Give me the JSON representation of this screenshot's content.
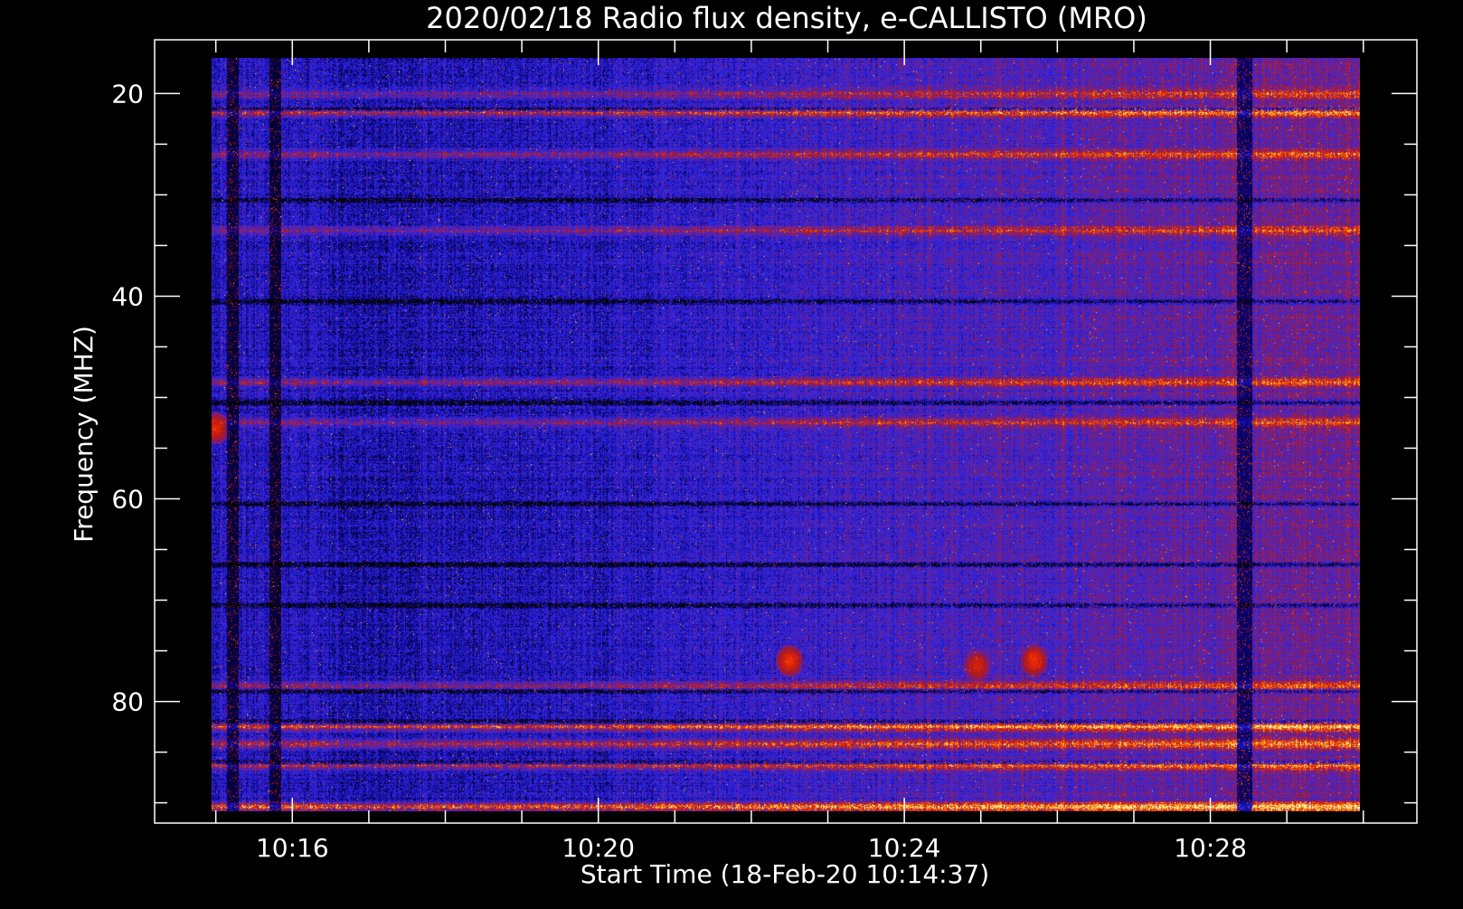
{
  "chart_data": {
    "type": "heatmap",
    "title": "2020/02/18  Radio flux density, e-CALLISTO (MRO)",
    "xlabel": "Start Time (18-Feb-20 10:14:37)",
    "ylabel": "Frequency (MHZ)",
    "x_axis": {
      "unit": "minutes after 10:00",
      "range": [
        14.2,
        30.7
      ],
      "data_range": [
        14.95,
        29.95
      ],
      "major_ticks": [
        {
          "value": 16,
          "label": "10:16"
        },
        {
          "value": 20,
          "label": "10:20"
        },
        {
          "value": 24,
          "label": "10:24"
        },
        {
          "value": 28,
          "label": "10:28"
        }
      ],
      "minor_ticks": [
        15,
        17,
        18,
        19,
        21,
        22,
        23,
        25,
        26,
        27,
        29,
        30
      ]
    },
    "y_axis": {
      "unit": "MHz",
      "inverted": true,
      "range": [
        14.7,
        92.0
      ],
      "data_range": [
        16.5,
        90.8
      ],
      "major_ticks": [
        {
          "value": 20,
          "label": "20"
        },
        {
          "value": 40,
          "label": "40"
        },
        {
          "value": 60,
          "label": "60"
        },
        {
          "value": 80,
          "label": "80"
        }
      ],
      "minor_ticks": [
        25,
        30,
        35,
        45,
        50,
        55,
        65,
        70,
        75,
        85,
        90
      ]
    },
    "colormap": [
      "#000000",
      "#0a0070",
      "#1f1fe6",
      "#3b2bd8",
      "#6a1f9a",
      "#b01818",
      "#ff3000",
      "#ffb000",
      "#ffffc0"
    ],
    "background_level": 0.33,
    "intensity_trend": [
      {
        "minute": 15.0,
        "level": 0.28
      },
      {
        "minute": 17.0,
        "level": 0.22
      },
      {
        "minute": 20.0,
        "level": 0.26
      },
      {
        "minute": 24.0,
        "level": 0.38
      },
      {
        "minute": 28.0,
        "level": 0.45
      },
      {
        "minute": 30.0,
        "level": 0.48
      }
    ],
    "dark_time_bands": [
      {
        "start": 15.15,
        "end": 15.3
      },
      {
        "start": 15.7,
        "end": 15.85
      },
      {
        "start": 28.35,
        "end": 28.55
      }
    ],
    "dark_frequency_lines": [
      21.5,
      30.5,
      40.5,
      50.5,
      60.5,
      66.5,
      70.5,
      79,
      82,
      86
    ],
    "bright_frequency_bands": [
      {
        "freq": 20.0,
        "level": 0.6
      },
      {
        "freq": 21.8,
        "level": 0.75
      },
      {
        "freq": 26.0,
        "level": 0.62
      },
      {
        "freq": 33.5,
        "level": 0.58
      },
      {
        "freq": 48.5,
        "level": 0.6
      },
      {
        "freq": 52.5,
        "level": 0.6
      },
      {
        "freq": 78.5,
        "level": 0.62
      },
      {
        "freq": 82.5,
        "level": 0.78
      },
      {
        "freq": 84.2,
        "level": 0.72
      },
      {
        "freq": 86.3,
        "level": 0.7
      },
      {
        "freq": 90.4,
        "level": 0.85
      }
    ],
    "burst_patches": [
      {
        "minute": 22.5,
        "freq": 76.0,
        "level": 0.72
      },
      {
        "minute": 24.95,
        "freq": 76.5,
        "level": 0.68
      },
      {
        "minute": 25.7,
        "freq": 76.0,
        "level": 0.72
      },
      {
        "minute": 15.0,
        "freq": 53.0,
        "level": 0.7
      }
    ]
  }
}
